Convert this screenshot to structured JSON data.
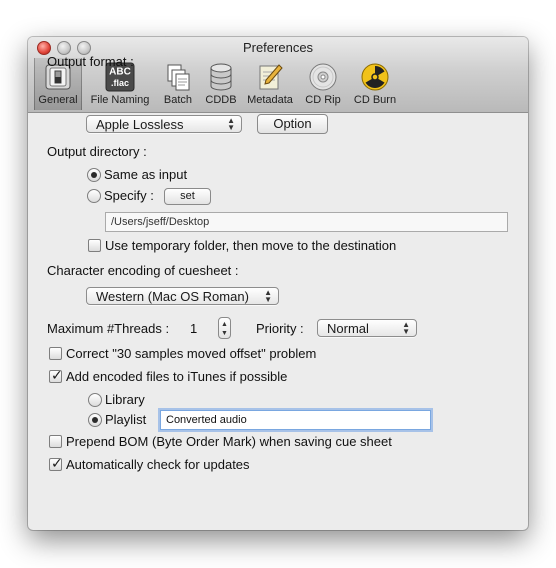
{
  "window": {
    "title": "Preferences"
  },
  "toolbar": {
    "items": [
      {
        "label": "General",
        "icon": "general-switch-icon",
        "selected": true
      },
      {
        "label": "File Naming",
        "icon": "abc-flac-icon",
        "icon_text_top": "ABC",
        "icon_text_bottom": ".flac"
      },
      {
        "label": "Batch",
        "icon": "batch-documents-icon"
      },
      {
        "label": "CDDB",
        "icon": "database-icon"
      },
      {
        "label": "Metadata",
        "icon": "pencil-notepad-icon"
      },
      {
        "label": "CD Rip",
        "icon": "cd-disc-icon"
      },
      {
        "label": "CD Burn",
        "icon": "radiation-icon"
      }
    ]
  },
  "general": {
    "output_format_label": "Output format :",
    "output_format_value": "Apple Lossless",
    "option_button": "Option",
    "output_directory_label": "Output directory :",
    "same_as_input_label": "Same as input",
    "same_as_input_selected": true,
    "specify_label": "Specify :",
    "specify_selected": false,
    "set_button": "set",
    "directory_path": "/Users/jseff/Desktop",
    "temp_folder_label": "Use temporary folder, then move to the destination",
    "temp_folder_checked": false,
    "cuesheet_encoding_label": "Character encoding of cuesheet :",
    "cuesheet_encoding_value": "Western (Mac OS Roman)",
    "max_threads_label": "Maximum #Threads :",
    "max_threads_value": "1",
    "priority_label": "Priority :",
    "priority_value": "Normal",
    "correct_offset_label": "Correct \"30 samples moved offset\" problem",
    "correct_offset_checked": false,
    "add_itunes_label": "Add encoded files to iTunes if possible",
    "add_itunes_checked": true,
    "library_label": "Library",
    "library_selected": false,
    "playlist_label": "Playlist",
    "playlist_selected": true,
    "playlist_name": "Converted audio",
    "prepend_bom_label": "Prepend BOM (Byte Order Mark) when saving cue sheet",
    "prepend_bom_checked": false,
    "auto_update_label": "Automatically check for updates",
    "auto_update_checked": true
  }
}
